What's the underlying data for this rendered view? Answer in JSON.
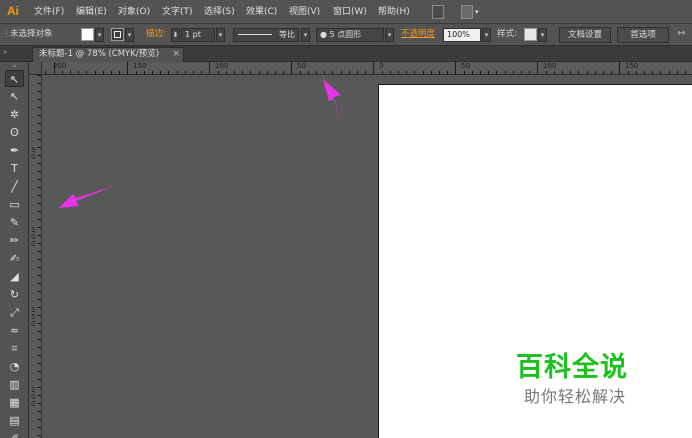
{
  "app": {
    "logo": "Ai"
  },
  "menu": {
    "items": [
      "文件(F)",
      "编辑(E)",
      "对象(O)",
      "文字(T)",
      "选择(S)",
      "效果(C)",
      "视图(V)",
      "窗口(W)",
      "帮助(H)"
    ],
    "icons": [
      "bridge-icon",
      "arrange-documents-icon"
    ]
  },
  "control_bar": {
    "selection_status": "未选择对象",
    "fill_color": "#ffffff",
    "stroke_label": "描边:",
    "stroke_weight": "1 pt",
    "stroke_profile": "等比",
    "brush": "5 点圆形",
    "opacity_label": "不透明度",
    "opacity_value": "100%",
    "style_label": "样式:",
    "doc_setup_button": "文档设置",
    "preferences_button": "首选项"
  },
  "document_tab": {
    "title": "未标题-1 @ 78% (CMYK/预览)",
    "close": "×"
  },
  "ruler_h": {
    "labels": [
      "200",
      "150",
      "100",
      "50",
      "0",
      "50",
      "100",
      "150"
    ]
  },
  "ruler_v": {
    "labels": [
      "5 0",
      "1 0 0",
      "1 5 0",
      "2 0 0"
    ]
  },
  "toolbar": {
    "tools": [
      {
        "name": "selection-tool",
        "glyph": "↖"
      },
      {
        "name": "direct-selection-tool",
        "glyph": "↖"
      },
      {
        "name": "magic-wand-tool",
        "glyph": "✲"
      },
      {
        "name": "lasso-tool",
        "glyph": "ʘ"
      },
      {
        "name": "pen-tool",
        "glyph": "✒"
      },
      {
        "name": "type-tool",
        "glyph": "T"
      },
      {
        "name": "line-tool",
        "glyph": "╱"
      },
      {
        "name": "rectangle-tool",
        "glyph": "▭"
      },
      {
        "name": "paintbrush-tool",
        "glyph": "✎"
      },
      {
        "name": "pencil-tool",
        "glyph": "✏"
      },
      {
        "name": "blob-brush-tool",
        "glyph": "✍"
      },
      {
        "name": "eraser-tool",
        "glyph": "◢"
      },
      {
        "name": "rotate-tool",
        "glyph": "↻"
      },
      {
        "name": "scale-tool",
        "glyph": "⤢"
      },
      {
        "name": "width-tool",
        "glyph": "≈"
      },
      {
        "name": "free-transform-tool",
        "glyph": "⌗"
      },
      {
        "name": "shape-builder-tool",
        "glyph": "◔"
      },
      {
        "name": "graph-tool",
        "glyph": "▥"
      },
      {
        "name": "mesh-tool",
        "glyph": "▦"
      },
      {
        "name": "gradient-tool",
        "glyph": "▤"
      },
      {
        "name": "eyedropper-tool",
        "glyph": "✐"
      }
    ]
  },
  "watermark": {
    "title": "百科全说",
    "subtitle": "助你轻松解决",
    "color": "#1dc11d"
  },
  "annotations": {
    "arrow_color": "#e832e8"
  }
}
